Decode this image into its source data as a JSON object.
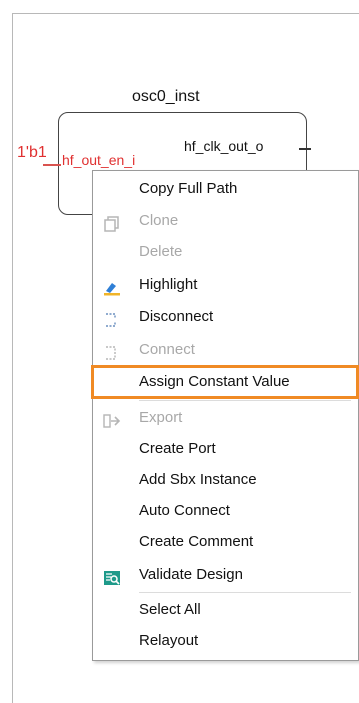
{
  "diagram": {
    "instance_name": "osc0_inst",
    "constant_label": "1'b1",
    "input_port": "hf_out_en_i",
    "output_port": "hf_clk_out_o"
  },
  "context_menu": {
    "items": [
      {
        "label": "Copy Full Path",
        "enabled": true,
        "icon": ""
      },
      {
        "label": "Clone",
        "enabled": false,
        "icon": "clone-icon"
      },
      {
        "label": "Delete",
        "enabled": false,
        "icon": ""
      },
      {
        "label": "Highlight",
        "enabled": true,
        "icon": "highlight-icon"
      },
      {
        "label": "Disconnect",
        "enabled": true,
        "icon": "disconnect-icon"
      },
      {
        "label": "Connect",
        "enabled": false,
        "icon": "connect-icon"
      },
      {
        "label": "Assign Constant Value",
        "enabled": true,
        "icon": "",
        "selected": true
      },
      {
        "label": "Export",
        "enabled": false,
        "icon": "export-icon"
      },
      {
        "label": "Create Port",
        "enabled": true,
        "icon": ""
      },
      {
        "label": "Add Sbx Instance",
        "enabled": true,
        "icon": ""
      },
      {
        "label": "Auto Connect",
        "enabled": true,
        "icon": ""
      },
      {
        "label": "Create Comment",
        "enabled": true,
        "icon": ""
      },
      {
        "label": "Validate Design",
        "enabled": true,
        "icon": "validate-icon"
      },
      {
        "label": "Select All",
        "enabled": true,
        "icon": ""
      },
      {
        "label": "Relayout",
        "enabled": true,
        "icon": ""
      }
    ],
    "highlight_color": "#f08a24"
  }
}
